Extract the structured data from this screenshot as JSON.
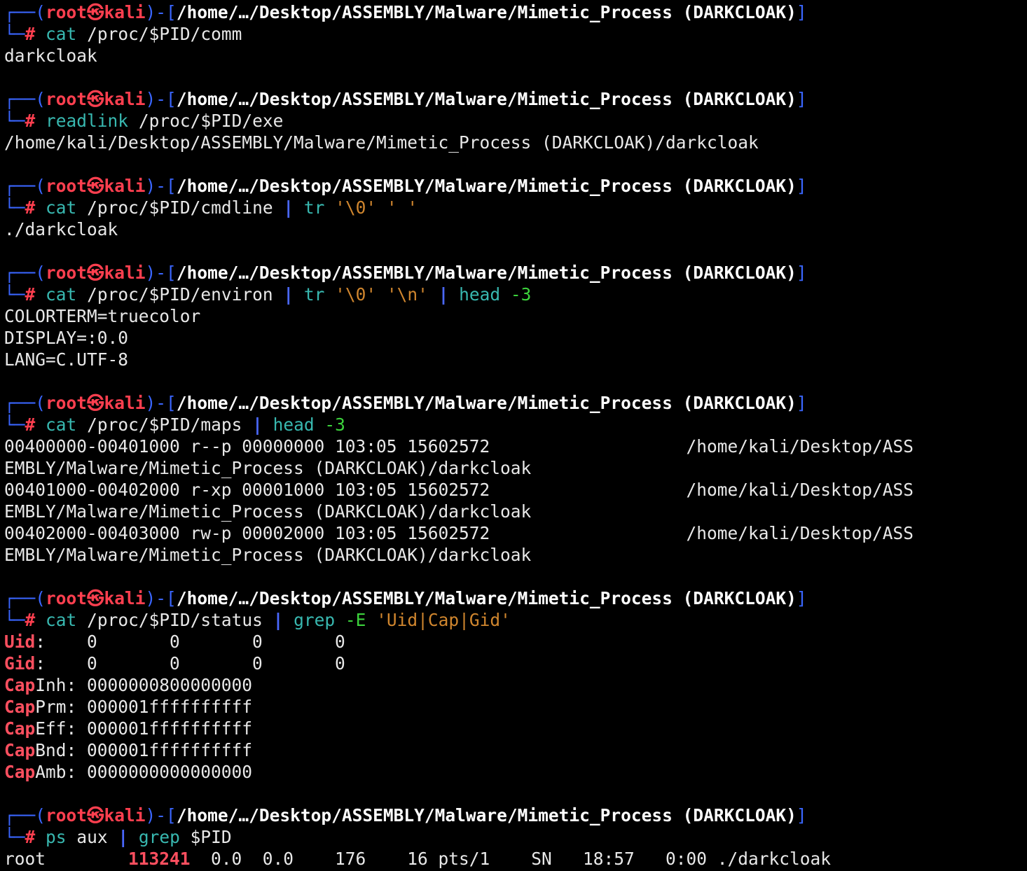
{
  "prompt": {
    "user": "root",
    "skull": "㉿",
    "host": "kali",
    "path": "/home/…/Desktop/ASSEMBLY/Malware/Mimetic_Process (DARKCLOAK)",
    "symbol": "#"
  },
  "blocks": [
    {
      "command": {
        "cmd": "cat",
        "args": " /proc/$PID/comm"
      },
      "output": [
        "darkcloak"
      ]
    },
    {
      "command": {
        "cmd": "readlink",
        "args": " /proc/$PID/exe"
      },
      "output": [
        "/home/kali/Desktop/ASSEMBLY/Malware/Mimetic_Process (DARKCLOAK)/darkcloak"
      ]
    },
    {
      "command": {
        "cmd": "cat",
        "args": " /proc/$PID/cmdline ",
        "pipe1": "|",
        "cmd2": " tr",
        "str1": " '\\0' ' '"
      },
      "output": [
        "./darkcloak"
      ]
    },
    {
      "command": {
        "cmd": "cat",
        "args": " /proc/$PID/environ ",
        "pipe1": "|",
        "cmd2": " tr",
        "str1": " '\\0' '\\n' ",
        "pipe2": "|",
        "cmd3": " head",
        "flag": " -3"
      },
      "output": [
        "COLORTERM=truecolor",
        "DISPLAY=:0.0",
        "LANG=C.UTF-8"
      ]
    },
    {
      "command": {
        "cmd": "cat",
        "args": " /proc/$PID/maps ",
        "pipe1": "|",
        "cmd2": " head",
        "flag": " -3"
      },
      "output": [
        "00400000-00401000 r--p 00000000 103:05 15602572                   /home/kali/Desktop/ASS",
        "EMBLY/Malware/Mimetic_Process (DARKCLOAK)/darkcloak",
        "00401000-00402000 r-xp 00001000 103:05 15602572                   /home/kali/Desktop/ASS",
        "EMBLY/Malware/Mimetic_Process (DARKCLOAK)/darkcloak",
        "00402000-00403000 rw-p 00002000 103:05 15602572                   /home/kali/Desktop/ASS",
        "EMBLY/Malware/Mimetic_Process (DARKCLOAK)/darkcloak"
      ]
    },
    {
      "command": {
        "cmd": "cat",
        "args": " /proc/$PID/status ",
        "pipe1": "|",
        "cmd2": " grep",
        "flag": " -E",
        "str1": " 'Uid|Cap|Gid'"
      },
      "status_lines": [
        {
          "hl": "Uid",
          "rest": ":\t0\t0\t0\t0"
        },
        {
          "hl": "Gid",
          "rest": ":\t0\t0\t0\t0"
        },
        {
          "hl": "Cap",
          "rest": "Inh: 0000000800000000"
        },
        {
          "hl": "Cap",
          "rest": "Prm: 000001ffffffffff"
        },
        {
          "hl": "Cap",
          "rest": "Eff: 000001ffffffffff"
        },
        {
          "hl": "Cap",
          "rest": "Bnd: 000001ffffffffff"
        },
        {
          "hl": "Cap",
          "rest": "Amb: 0000000000000000"
        }
      ]
    },
    {
      "command": {
        "cmd": "ps",
        "args": " aux ",
        "pipe1": "|",
        "cmd2": " grep",
        "args2": " $PID"
      },
      "ps_line": {
        "pre": "root        ",
        "pid": "113241",
        "post": "  0.0  0.0    176    16 pts/1    SN   18:57   0:00 ./darkcloak"
      }
    }
  ]
}
